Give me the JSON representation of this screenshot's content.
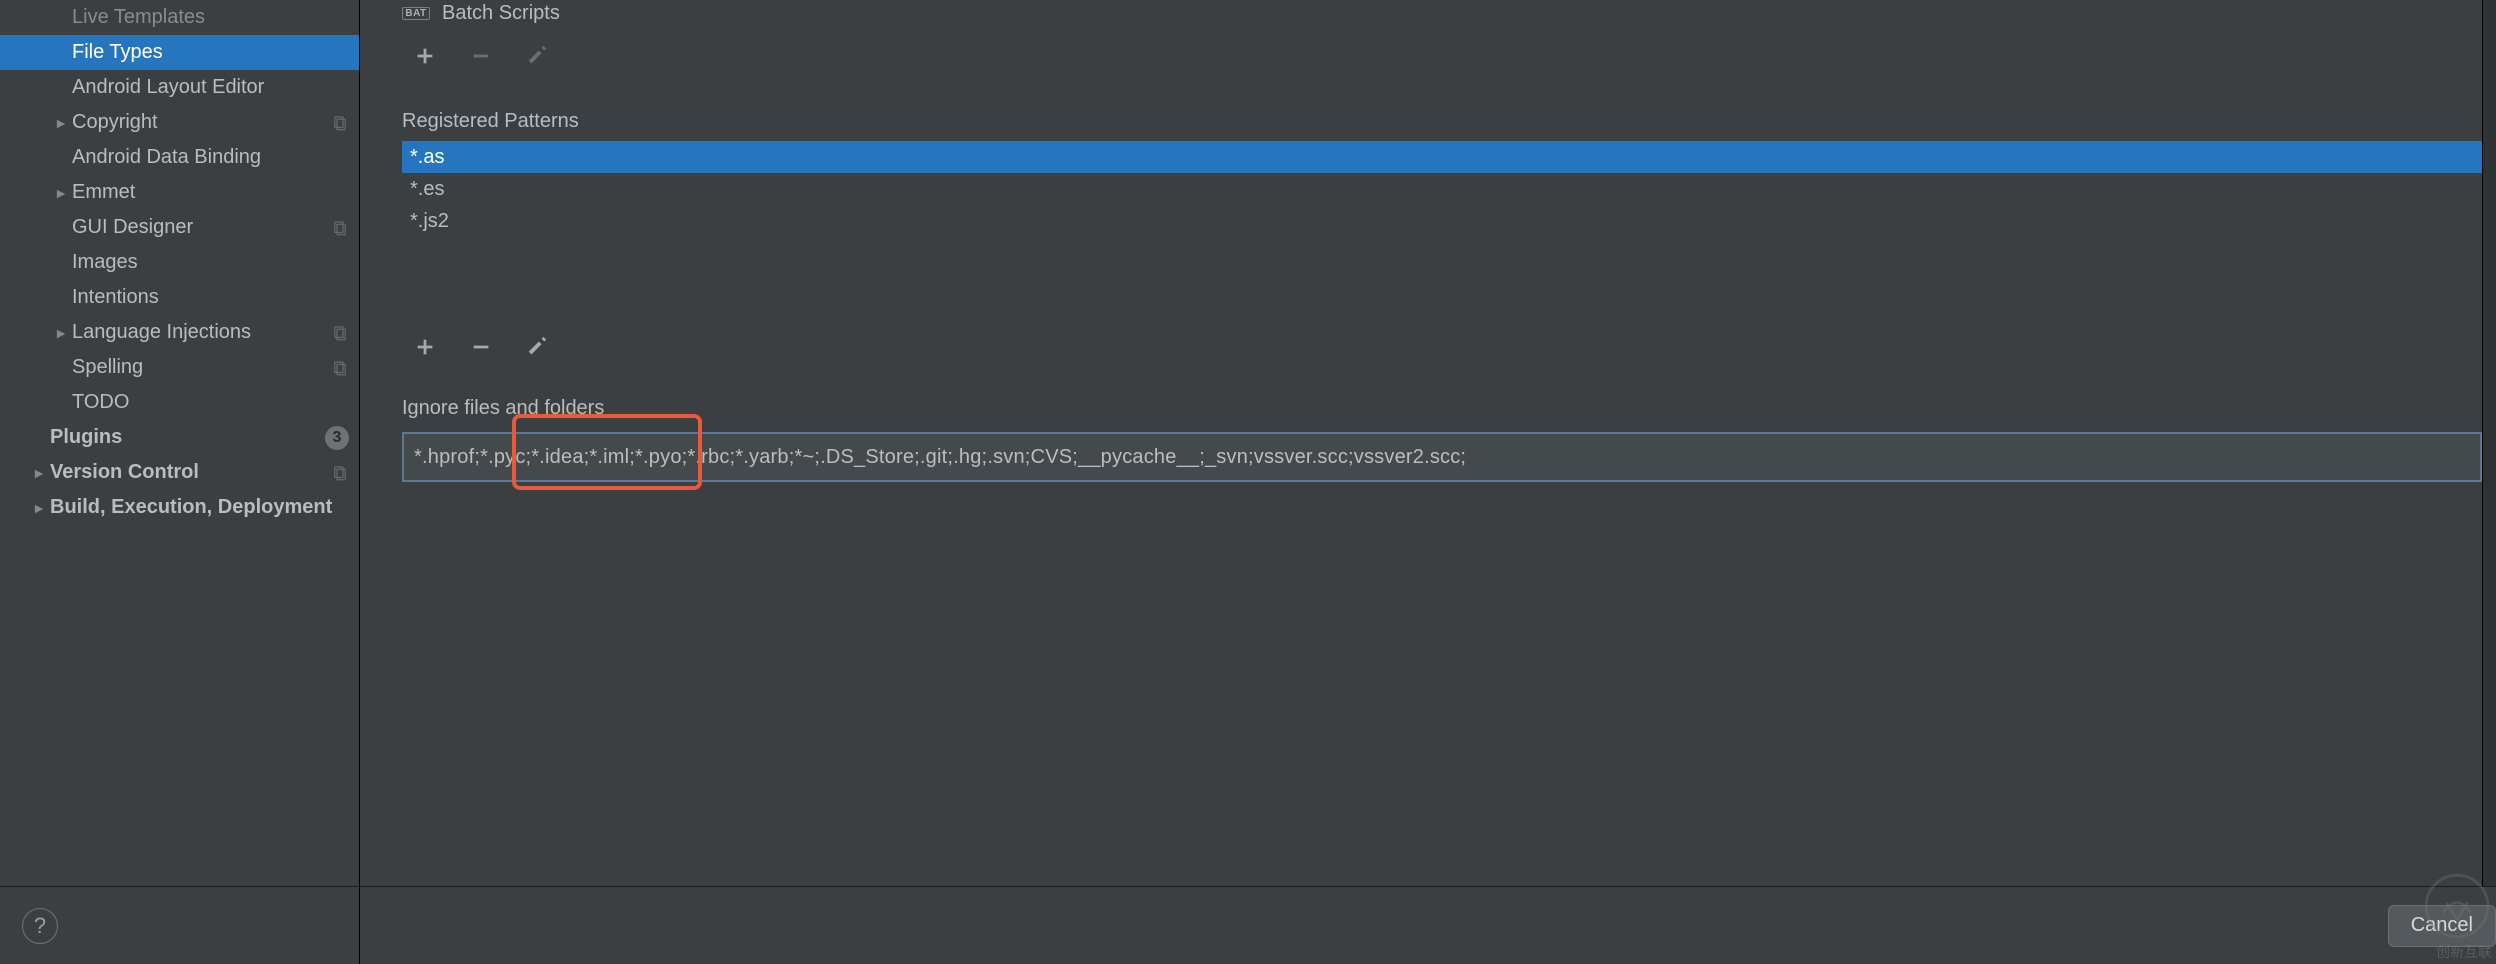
{
  "sidebar": {
    "items": [
      {
        "label": "Live Templates",
        "indent": 1,
        "chev": "",
        "dim": true,
        "selected": false,
        "proj": false,
        "badge": ""
      },
      {
        "label": "File Types",
        "indent": 1,
        "chev": "",
        "dim": false,
        "selected": true,
        "proj": false,
        "badge": ""
      },
      {
        "label": "Android Layout Editor",
        "indent": 1,
        "chev": "",
        "dim": false,
        "selected": false,
        "proj": false,
        "badge": ""
      },
      {
        "label": "Copyright",
        "indent": 1,
        "chev": "►",
        "dim": false,
        "selected": false,
        "proj": true,
        "badge": ""
      },
      {
        "label": "Android Data Binding",
        "indent": 1,
        "chev": "",
        "dim": false,
        "selected": false,
        "proj": false,
        "badge": ""
      },
      {
        "label": "Emmet",
        "indent": 1,
        "chev": "►",
        "dim": false,
        "selected": false,
        "proj": false,
        "badge": ""
      },
      {
        "label": "GUI Designer",
        "indent": 1,
        "chev": "",
        "dim": false,
        "selected": false,
        "proj": true,
        "badge": ""
      },
      {
        "label": "Images",
        "indent": 1,
        "chev": "",
        "dim": false,
        "selected": false,
        "proj": false,
        "badge": ""
      },
      {
        "label": "Intentions",
        "indent": 1,
        "chev": "",
        "dim": false,
        "selected": false,
        "proj": false,
        "badge": ""
      },
      {
        "label": "Language Injections",
        "indent": 1,
        "chev": "►",
        "dim": false,
        "selected": false,
        "proj": true,
        "badge": ""
      },
      {
        "label": "Spelling",
        "indent": 1,
        "chev": "",
        "dim": false,
        "selected": false,
        "proj": true,
        "badge": ""
      },
      {
        "label": "TODO",
        "indent": 1,
        "chev": "",
        "dim": false,
        "selected": false,
        "proj": false,
        "badge": ""
      },
      {
        "label": "Plugins",
        "indent": 0,
        "chev": "",
        "dim": false,
        "selected": false,
        "proj": false,
        "badge": "3"
      },
      {
        "label": "Version Control",
        "indent": 0,
        "chev": "►",
        "dim": false,
        "selected": false,
        "proj": true,
        "badge": ""
      },
      {
        "label": "Build, Execution, Deployment",
        "indent": 0,
        "chev": "►",
        "dim": false,
        "selected": false,
        "proj": false,
        "badge": ""
      }
    ],
    "help_tooltip": "?"
  },
  "main": {
    "recognized_types_visible_item": "Batch Scripts",
    "toolbar_top": {
      "add": "+",
      "remove": "−",
      "edit": "edit"
    },
    "patterns_label": "Registered Patterns",
    "patterns": [
      {
        "text": "*.as",
        "selected": true
      },
      {
        "text": "*.es",
        "selected": false
      },
      {
        "text": "*.js2",
        "selected": false
      }
    ],
    "toolbar_patterns": {
      "add": "+",
      "remove": "−",
      "edit": "edit"
    },
    "ignore_label": "Ignore files and folders",
    "ignore_value": "*.hprof;*.pyc;*.idea;*.iml;*.pyo;*.rbc;*.yarb;*~;.DS_Store;.git;.hg;.svn;CVS;__pycache__;_svn;vssver.scc;vssver2.scc;",
    "buttons": {
      "cancel": "Cancel"
    }
  },
  "watermark_text": "创新互联"
}
